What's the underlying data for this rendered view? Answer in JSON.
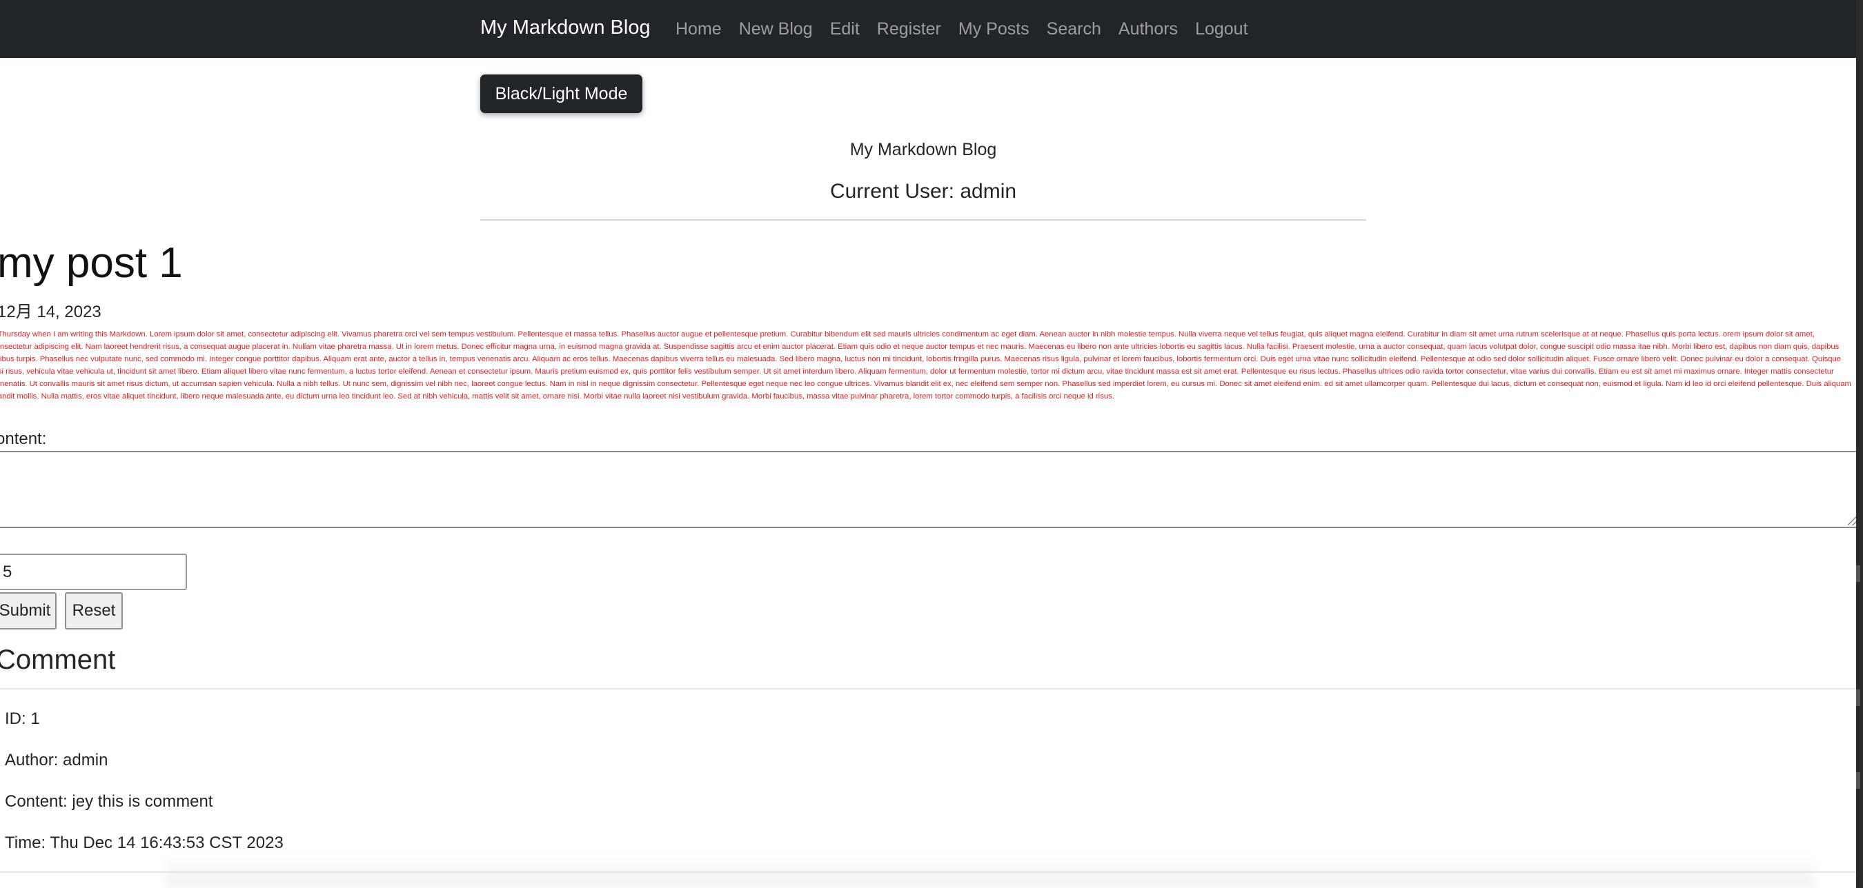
{
  "navbar": {
    "brand": "My Markdown Blog",
    "links": [
      "Home",
      "New Blog",
      "Edit",
      "Register",
      "My Posts",
      "Search",
      "Authors",
      "Logout"
    ]
  },
  "mode_button": "Black/Light Mode",
  "header": {
    "site_title": "My Markdown Blog",
    "current_user": "Current User: admin"
  },
  "post": {
    "title": "my post 1",
    "date": "12月 14, 2023",
    "body": "s Thursday when I am writing this Markdown. Lorem ipsum dolor sit amet, consectetur adipiscing elit. Vivamus pharetra orci vel sem tempus vestibulum. Pellentesque et massa tellus. Phasellus auctor augue et pellentesque pretium. Curabitur bibendum elit sed mauris ultricies condimentum ac eget diam. Aenean auctor in nibh molestie tempus. Nulla viverra neque vel tellus feugiat, quis aliquet magna eleifend. Curabitur in diam sit amet urna rutrum scelerisque at at neque. Phasellus quis porta lectus. orem ipsum dolor sit amet, consectetur adipiscing elit. Nam laoreet hendrerit risus, a consequat augue placerat in. Nullam vitae pharetra massa. Ut in lorem metus. Donec efficitur magna urna, in euismod magna gravida at. Suspendisse sagittis arcu et enim auctor placerat. Etiam quis odio et neque auctor tempus et nec mauris. Maecenas eu libero non ante ultricies lobortis eu sagittis lacus. Nulla facilisi. Praesent molestie, urna a auctor consequat, quam lacus volutpat dolor, congue suscipit odio massa itae nibh. Morbi libero est, dapibus non diam quis, dapibus finibus turpis. Phasellus nec vulputate nunc, sed commodo mi. Integer congue porttitor dapibus. Aliquam erat ante, auctor a tellus in, tempus venenatis arcu. Aliquam ac eros tellus. Maecenas dapibus viverra tellus eu malesuada. Sed libero magna, luctus non mi tincidunt, lobortis fringilla purus. Maecenas risus ligula, pulvinar et lorem faucibus, lobortis fermentum orci. Duis eget urna vitae nunc sollicitudin eleifend. Pellentesque at odio sed dolor sollicitudin aliquet. Fusce ornare libero velit. Donec pulvinar eu dolor a consequat. Quisque nisi risus, vehicula vitae vehicula ut, tincidunt sit amet libero. Etiam aliquet libero vitae nunc fermentum, a luctus tortor eleifend. Aenean et consectetur ipsum. Mauris pretium euismod ex, quis porttitor felis vestibulum semper. Ut sit amet interdum libero. Aliquam fermentum, dolor ut fermentum molestie, tortor mi dictum arcu, vitae tincidunt massa est sit amet erat. Pellentesque eu risus lectus. Phasellus ultrices odio ravida tortor consectetur, vitae varius dui convallis. Etiam eu est sit amet mi maximus ornare. Integer mattis consectetur venenatis. Ut convallis mauris sit amet risus dictum, ut accumsan sapien vehicula. Nulla a nibh tellus. Ut nunc sem, dignissim vel nibh nec, laoreet congue lectus. Nam in nisl in neque dignissim consectetur. Pellentesque eget neque nec leo congue ultrices. Vivamus blandit elit ex, nec eleifend sem semper non. Phasellus sed imperdiet lorem, eu cursus mi. Donec sit amet eleifend enim. ed sit amet ullamcorper quam. Pellentesque dui lacus, dictum et consequat non, euismod et ligula. Nam id leo id orci eleifend pellentesque. Duis aliquam blandit mollis. Nulla mattis, eros vitae aliquet tincidunt, libero neque malesuada ante, eu dictum urna leo tincidunt leo. Sed at nibh vehicula, mattis velit sit amet, ornare nisi. Morbi vitae nulla laoreet nisi vestibulum gravida. Morbi faucibus, massa vitae pulvinar pharetra, lorem tortor commodo turpis, a facilisis orci neque id risus."
  },
  "comment_form": {
    "content_label": "ontent:",
    "content_value": "",
    "id_value": "5",
    "submit_label": "Submit",
    "reset_label": "Reset"
  },
  "comments": {
    "heading": "Comment",
    "items": [
      {
        "id": "ID: 1",
        "author": "Author: admin",
        "content": "Content: jey this is comment",
        "time": "Time: Thu Dec 14 16:43:53 CST 2023"
      }
    ]
  },
  "colors": {
    "navbar_bg": "#212529",
    "post_body_text": "#e02020"
  }
}
